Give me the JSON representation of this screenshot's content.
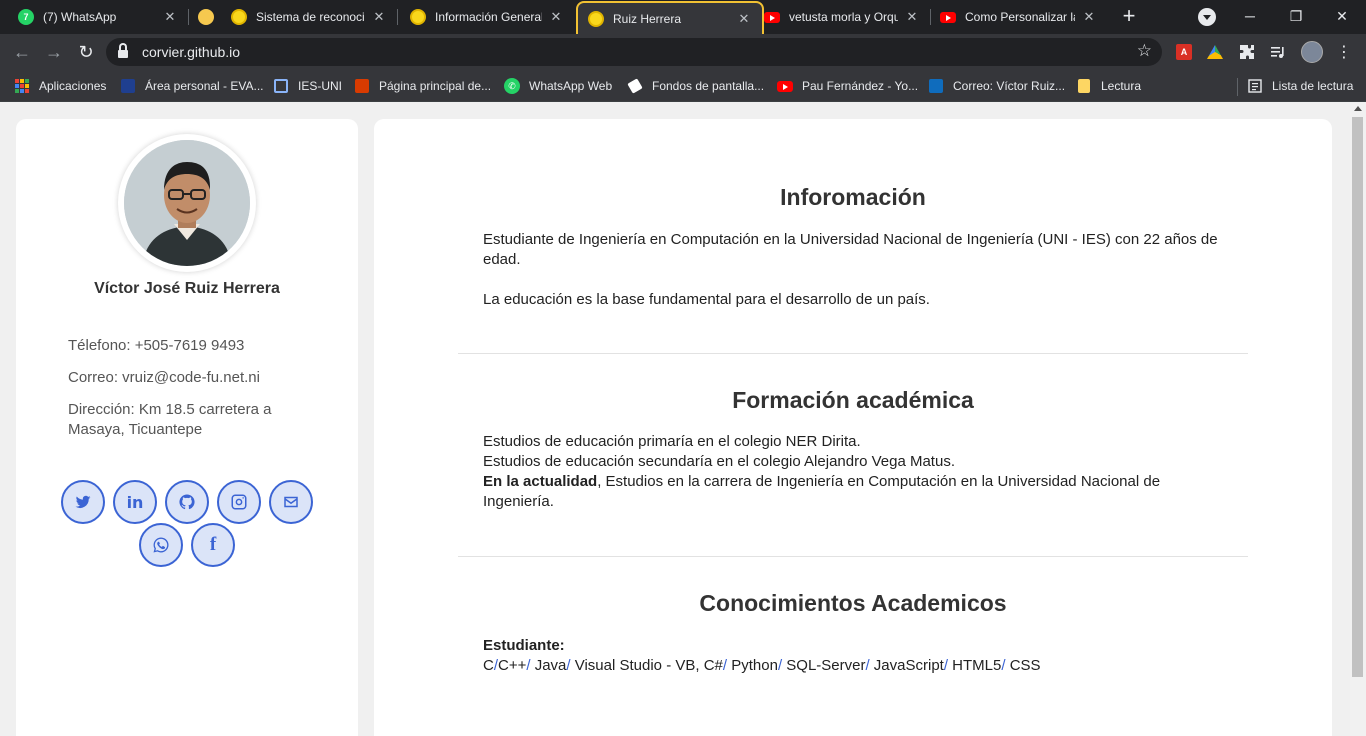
{
  "browser": {
    "tabs": [
      {
        "title": "(7) WhatsApp",
        "icon": "whatsapp-icon"
      },
      {
        "title": "",
        "icon": "yellow-circle-icon"
      },
      {
        "title": "Sistema de reconocim",
        "icon": "emoji-icon"
      },
      {
        "title": "Información General",
        "icon": "emoji-icon"
      },
      {
        "title": "Ruiz Herrera",
        "icon": "emoji-icon",
        "active": true
      },
      {
        "title": "vetusta morla y Orqu",
        "icon": "youtube-icon"
      },
      {
        "title": "Como Personalizar la",
        "icon": "youtube-icon"
      }
    ],
    "new_tab": "+",
    "window_controls": {
      "minimize": "─",
      "restore": "❐",
      "close": "✕"
    },
    "url": "corvier.github.io",
    "bookmarks": [
      {
        "label": "Aplicaciones",
        "icon": "apps-grid-icon"
      },
      {
        "label": "Área personal - EVA...",
        "icon": "eva-icon"
      },
      {
        "label": "IES-UNI",
        "icon": "ies-icon"
      },
      {
        "label": "Página principal de...",
        "icon": "office-icon"
      },
      {
        "label": "WhatsApp Web",
        "icon": "whatsapp-icon"
      },
      {
        "label": "Fondos de pantalla...",
        "icon": "fondos-icon"
      },
      {
        "label": "Pau Fernández - Yo...",
        "icon": "youtube-icon"
      },
      {
        "label": "Correo: Víctor Ruiz...",
        "icon": "outlook-icon"
      },
      {
        "label": "Lectura",
        "icon": "folder-icon"
      }
    ],
    "reading_list": "Lista de lectura",
    "accent_color": "#f2c233"
  },
  "profile": {
    "name": "Víctor José Ruiz Herrera",
    "phone": "Télefono: +505-7619 9493",
    "email": "Correo: vruiz@code-fu.net.ni",
    "address": "Dirección: Km 18.5 carretera a Masaya, Ticuantepe",
    "social": [
      "twitter",
      "linkedin",
      "github",
      "instagram",
      "email",
      "whatsapp",
      "facebook"
    ],
    "social_color": "#3b64d4"
  },
  "sections": {
    "info": {
      "title": "Inforomación",
      "p1": "Estudiante de Ingeniería en Computación en la Universidad Nacional de Ingeniería (UNI - IES) con 22 años de edad.",
      "p2": "La educación es la base fundamental para el desarrollo de un país."
    },
    "education": {
      "title": "Formación académica",
      "line1": "Estudios de educación primaría en el colegio NER Dirita.",
      "line2": "Estudios de educación secundaría en el colegio Alejandro Vega Matus.",
      "line3_bold": "En la actualidad",
      "line3_rest": ", Estudios en la carrera de Ingeniería en Computación en la Universidad Nacional de Ingeniería."
    },
    "skills": {
      "title": "Conocimientos Academicos",
      "label": "Estudiante:",
      "items": [
        "C",
        "C++",
        " Java",
        " Visual Studio - VB, C#",
        " Python",
        " SQL-Server",
        " JavaScript",
        " HTML5",
        " CSS"
      ]
    }
  }
}
